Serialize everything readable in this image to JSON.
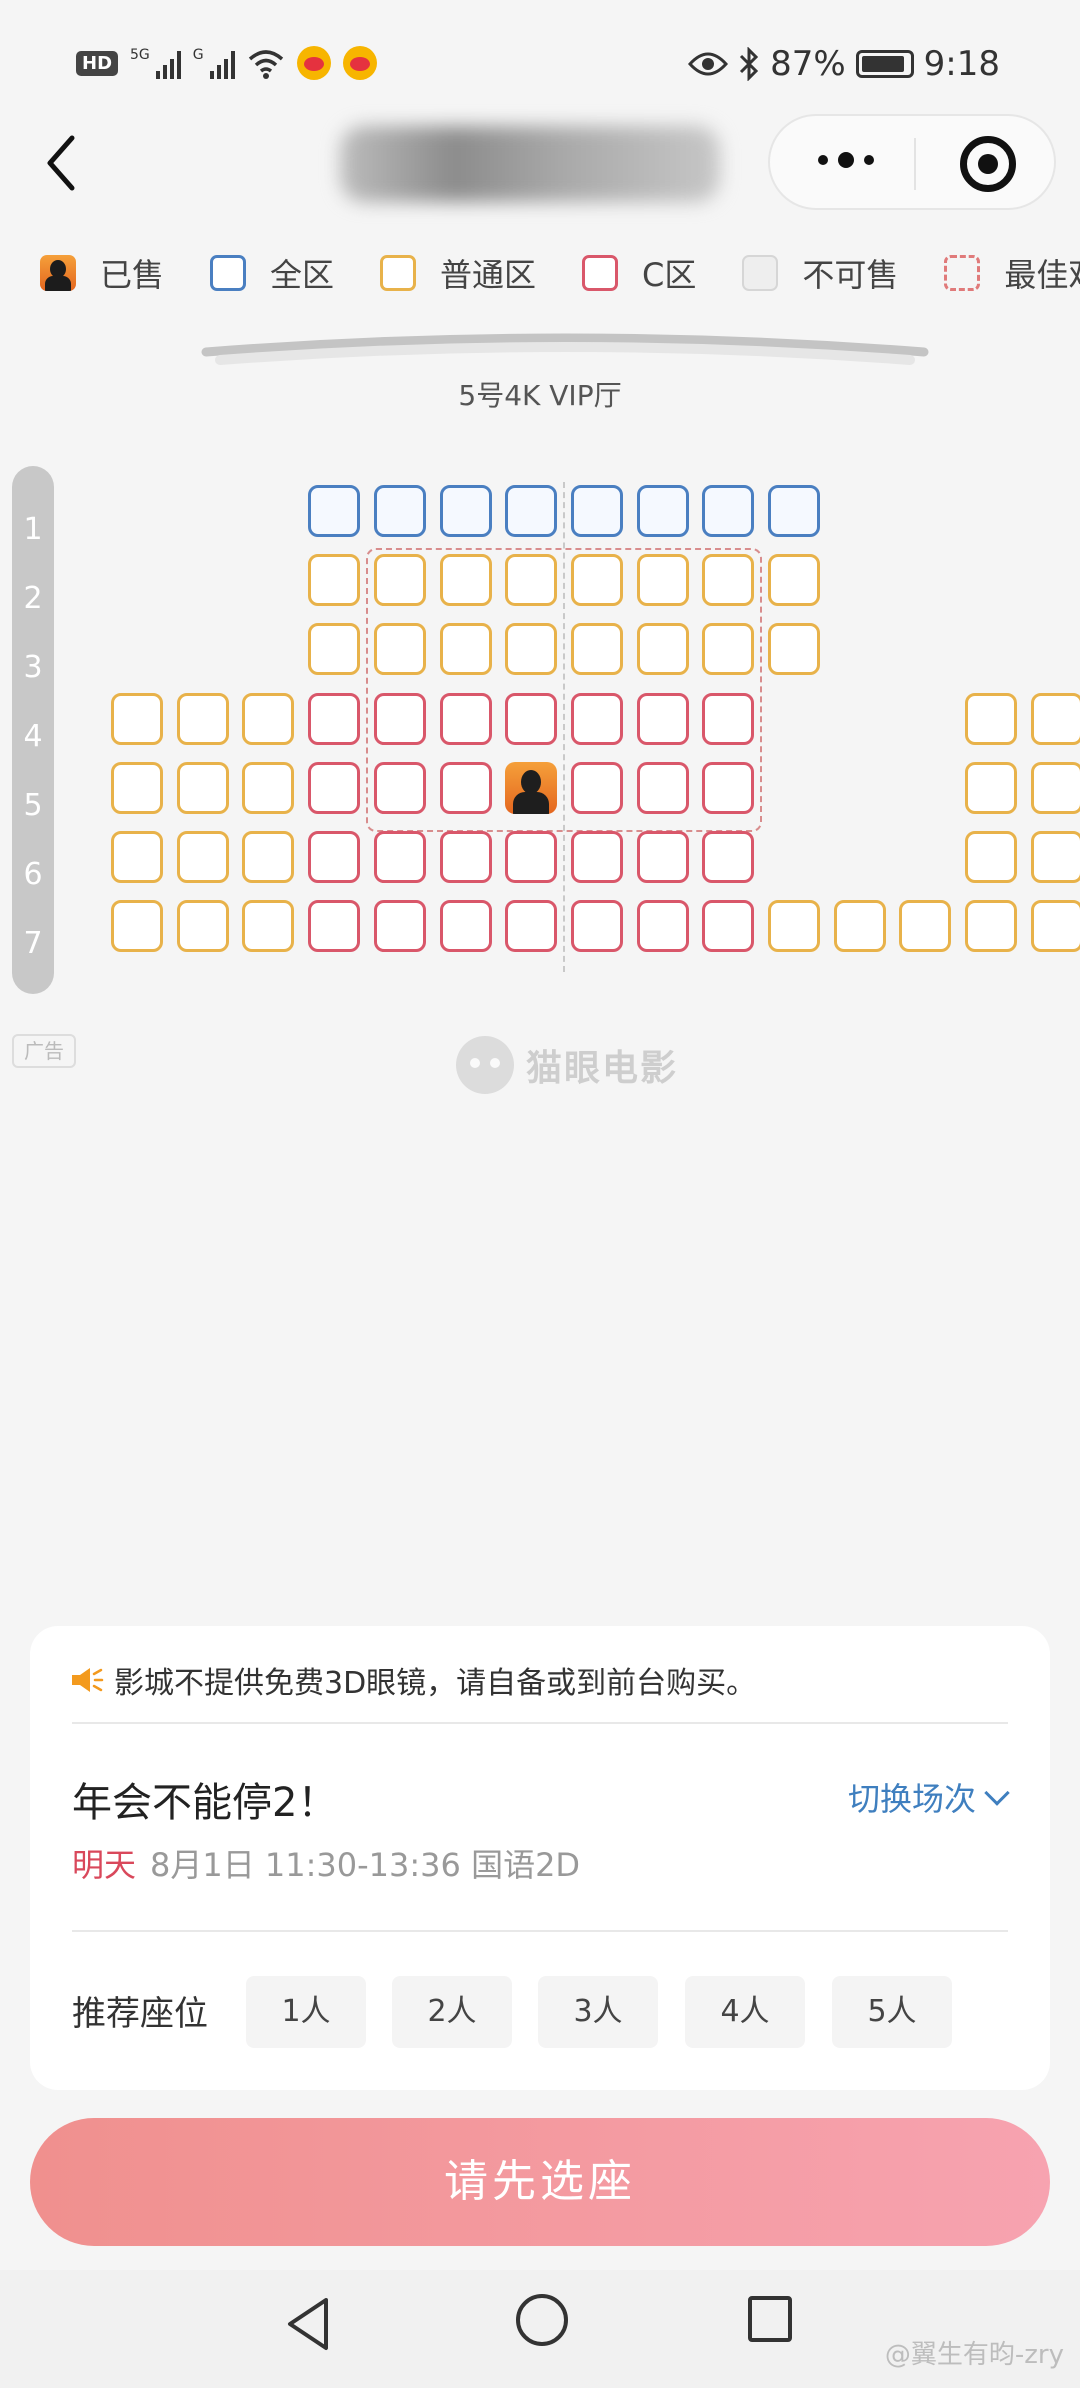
{
  "status_bar": {
    "hd": "HD",
    "sim1": "5G",
    "sim2": "G",
    "battery": "87%",
    "time": "9:18"
  },
  "header": {
    "back_icon": "chevron-left-icon",
    "more_icon": "more-dots-icon",
    "close_icon": "target-icon"
  },
  "legend": [
    {
      "label": "已售",
      "style": "sold"
    },
    {
      "label": "全区",
      "style": "blue"
    },
    {
      "label": "普通区",
      "style": "yellow"
    },
    {
      "label": "C区",
      "style": "red"
    },
    {
      "label": "不可售",
      "style": "gray"
    },
    {
      "label": "最佳观",
      "style": "dash"
    }
  ],
  "hall": {
    "screen_label": "5号4K VIP厅",
    "rows": [
      "1",
      "2",
      "3",
      "4",
      "5",
      "6",
      "7"
    ],
    "seats": [
      [
        "",
        "",
        "",
        "b",
        "b",
        "b",
        "b",
        "b",
        "b",
        "b",
        "b",
        "",
        "",
        "",
        ""
      ],
      [
        "",
        "",
        "",
        "y",
        "y",
        "y",
        "y",
        "y",
        "y",
        "y",
        "y",
        "",
        "",
        "",
        ""
      ],
      [
        "",
        "",
        "",
        "y",
        "y",
        "y",
        "y",
        "y",
        "y",
        "y",
        "y",
        "",
        "",
        "",
        ""
      ],
      [
        "y",
        "y",
        "y",
        "r",
        "r",
        "r",
        "r",
        "r",
        "r",
        "r",
        "",
        "",
        "",
        "y",
        "y"
      ],
      [
        "y",
        "y",
        "y",
        "r",
        "r",
        "r",
        "s",
        "r",
        "r",
        "r",
        "",
        "",
        "",
        "y",
        "y"
      ],
      [
        "y",
        "y",
        "y",
        "r",
        "r",
        "r",
        "r",
        "r",
        "r",
        "r",
        "",
        "",
        "",
        "y",
        "y"
      ],
      [
        "y",
        "y",
        "y",
        "r",
        "r",
        "r",
        "r",
        "r",
        "r",
        "r",
        "y",
        "y",
        "y",
        "y",
        "y"
      ]
    ]
  },
  "ad_label": "广告",
  "watermark_logo": "猫眼电影",
  "card": {
    "notice": "影城不提供免费3D眼镜，请自备或到前台购买。",
    "movie_title": "年会不能停2！",
    "switch_label": "切换场次",
    "showtime_day": "明天",
    "showtime_detail": "8月1日 11:30-13:36 国语2D",
    "recommend_label": "推荐座位",
    "recommend_options": [
      "1人",
      "2人",
      "3人",
      "4人",
      "5人"
    ]
  },
  "cta_label": "请先选座",
  "weibo_watermark": "@翼生有昀-zry",
  "colors": {
    "accent_blue": "#4a7fc1",
    "accent_yellow": "#e8b24a",
    "accent_red": "#d9576a",
    "cta_pink": "#f0908e"
  }
}
